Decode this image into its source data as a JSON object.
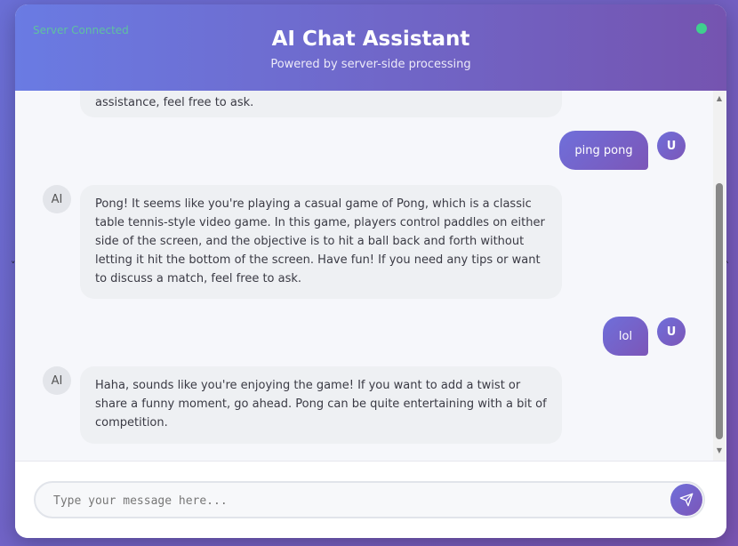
{
  "header": {
    "server_status": "Server Connected",
    "title": "AI Chat Assistant",
    "subtitle": "Powered by server-side processing"
  },
  "messages": [
    {
      "role": "ai",
      "avatar": "AI",
      "text": "assistance, feel free to ask."
    },
    {
      "role": "user",
      "avatar": "U",
      "text": "ping pong"
    },
    {
      "role": "ai",
      "avatar": "AI",
      "text": "Pong! It seems like you're playing a casual game of Pong, which is a classic table tennis-style video game. In this game, players control paddles on either side of the screen, and the objective is to hit a ball back and forth without letting it hit the bottom of the screen. Have fun! If you need any tips or want to discuss a match, feel free to ask."
    },
    {
      "role": "user",
      "avatar": "U",
      "text": "lol"
    },
    {
      "role": "ai",
      "avatar": "AI",
      "text": "Haha, sounds like you're enjoying the game! If you want to add a twist or share a funny moment, go ahead. Pong can be quite entertaining with a bit of competition."
    }
  ],
  "input": {
    "placeholder": "Type your message here...",
    "value": ""
  },
  "icons": {
    "send": "send-icon",
    "status": "status-dot"
  },
  "colors": {
    "accent": "#7562c8",
    "status_ok": "#3fcf8e"
  }
}
